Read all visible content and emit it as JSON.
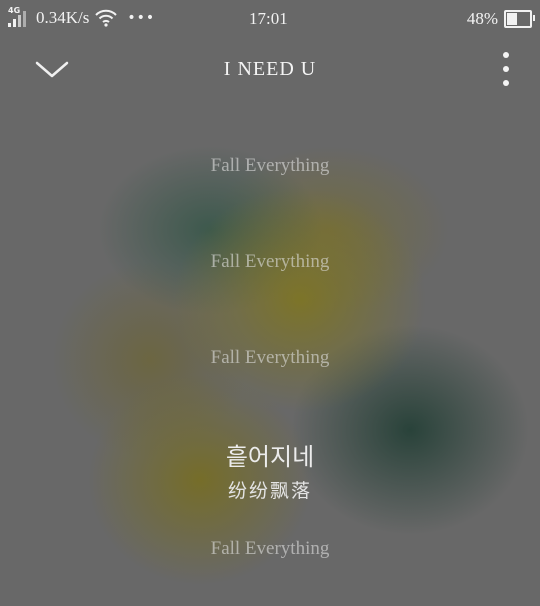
{
  "status_bar": {
    "network_type": "4G",
    "speed": "0.34K/s",
    "more_indicator": "•••",
    "time": "17:01",
    "battery_percent": "48%",
    "battery_level": 0.48
  },
  "header": {
    "song_title": "I NEED U",
    "collapse_icon": "chevron-down-icon",
    "more_icon": "more-vertical-icon"
  },
  "lyrics": {
    "line_1": "Fall Everything",
    "line_2": "Fall Everything",
    "line_3": "Fall Everything",
    "current_line": "흩어지네",
    "current_translation": "纷纷飘落",
    "line_4": "Fall Everything"
  }
}
